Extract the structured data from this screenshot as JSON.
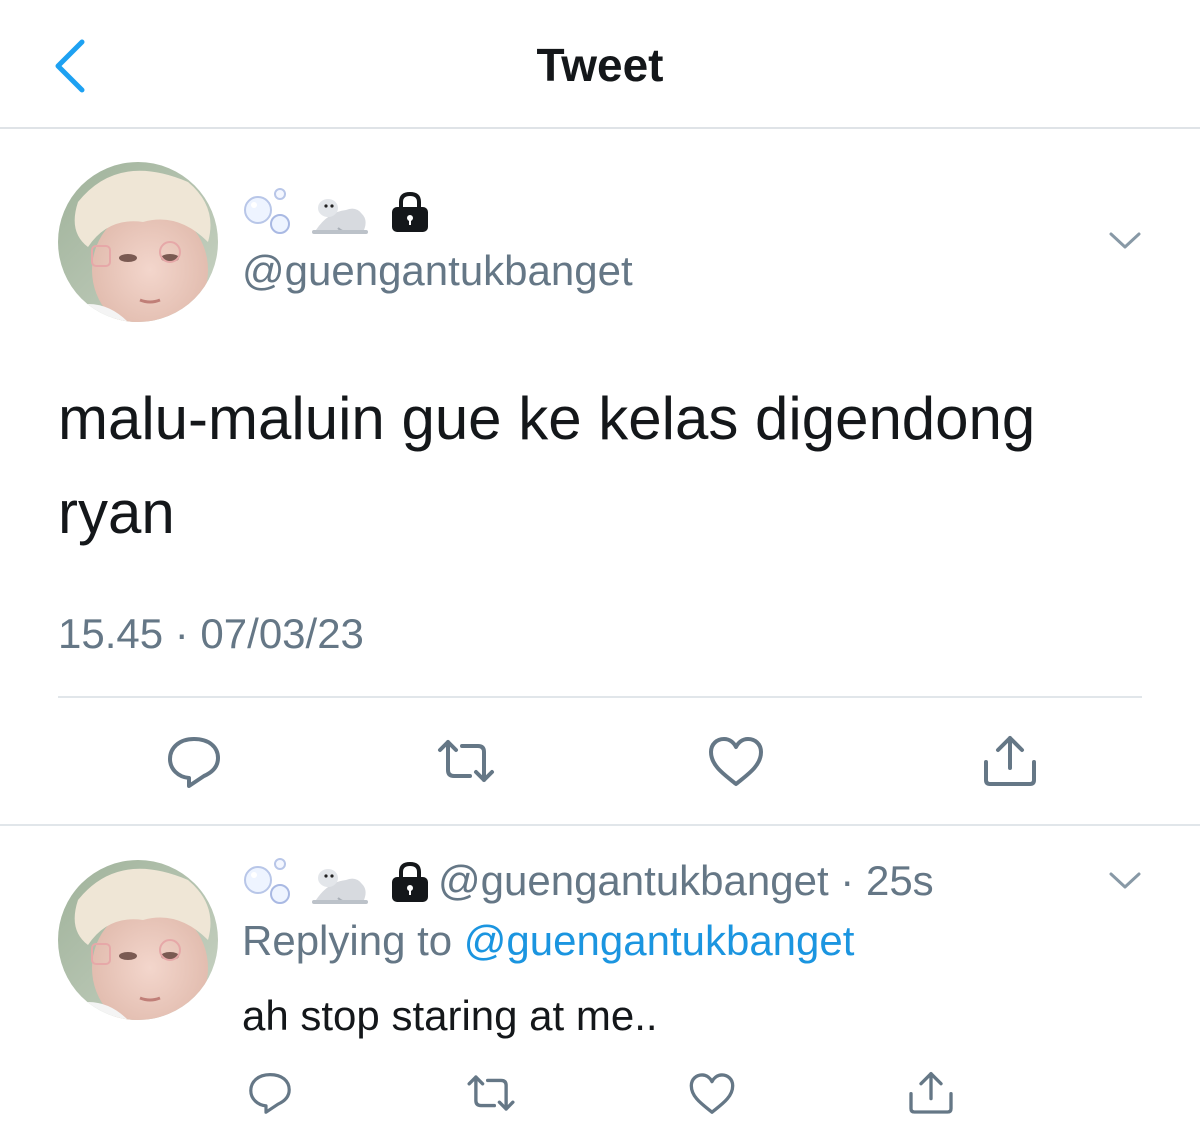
{
  "header": {
    "title": "Tweet",
    "back_icon": "chevron-left-icon",
    "accent_color": "#1da1f2"
  },
  "tweet": {
    "display_name_icons": [
      "bubbles-icon",
      "seal-icon",
      "lock-icon"
    ],
    "handle": "@guengantukbanget",
    "text": "malu-maluin gue ke kelas digendong ryan",
    "timestamp": "15.45 · 07/03/23",
    "actions": [
      "reply-icon",
      "retweet-icon",
      "like-icon",
      "share-icon"
    ]
  },
  "reply": {
    "display_name_icons": [
      "bubbles-icon",
      "seal-icon",
      "lock-icon"
    ],
    "handle": "@guengantukbanget",
    "separator": " · ",
    "time": "25s",
    "replying_prefix": "Replying to ",
    "replying_to": "@guengantukbanget",
    "text": "ah stop staring at me..",
    "actions": [
      "reply-icon",
      "retweet-icon",
      "like-icon",
      "share-icon"
    ]
  },
  "colors": {
    "text": "#14171a",
    "secondary": "#657786",
    "link": "#1b95e0",
    "divider": "#e1e6ea"
  }
}
